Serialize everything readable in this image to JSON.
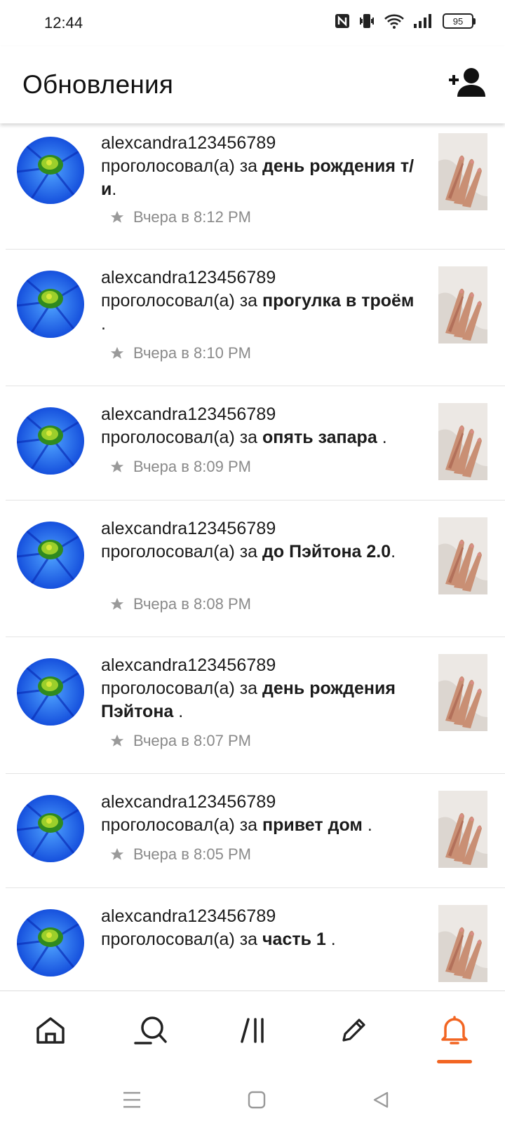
{
  "status_bar": {
    "time": "12:44",
    "battery": "95",
    "icons": [
      "nfc-icon",
      "vibrate-icon",
      "wifi-icon",
      "signal-icon",
      "battery-icon"
    ]
  },
  "header": {
    "title": "Обновления",
    "action_icon": "add-user-icon"
  },
  "feed": {
    "items": [
      {
        "user": "alexcandra123456789",
        "action": "проголосовал(а) за ",
        "title": "день рождения т/и",
        "suffix": ".",
        "time": "Вчера в 8:12 PM"
      },
      {
        "user": "alexcandra123456789",
        "action": "проголосовал(а) за ",
        "title": "прогулка в троём ",
        "suffix": ".",
        "time": "Вчера в 8:10 PM"
      },
      {
        "user": "alexcandra123456789",
        "action": "проголосовал(а) за ",
        "title": "опять запара ",
        "suffix": ".",
        "time": "Вчера в 8:09 PM"
      },
      {
        "user": "alexcandra123456789",
        "action": "проголосовал(а) за ",
        "title": "до Пэйтона 2.0",
        "suffix": ".",
        "time": "Вчера в 8:08 PM"
      },
      {
        "user": "alexcandra123456789",
        "action": "проголосовал(а) за ",
        "title": "день рождения Пэйтона ",
        "suffix": ".",
        "time": "Вчера в 8:07 PM"
      },
      {
        "user": "alexcandra123456789",
        "action": "проголосовал(а) за ",
        "title": "привет дом ",
        "suffix": ".",
        "time": "Вчера в 8:05 PM"
      },
      {
        "user": "alexcandra123456789",
        "action": "проголосовал(а) за ",
        "title": "часть 1 ",
        "suffix": ".",
        "time": ""
      }
    ]
  },
  "bottom_nav": {
    "items": [
      "home-icon",
      "search-icon",
      "library-icon",
      "write-icon",
      "notifications-icon"
    ],
    "active": "notifications-icon",
    "accent_color": "#f26522"
  },
  "system_nav": {
    "items": [
      "menu-icon",
      "home-square-icon",
      "back-icon"
    ]
  }
}
